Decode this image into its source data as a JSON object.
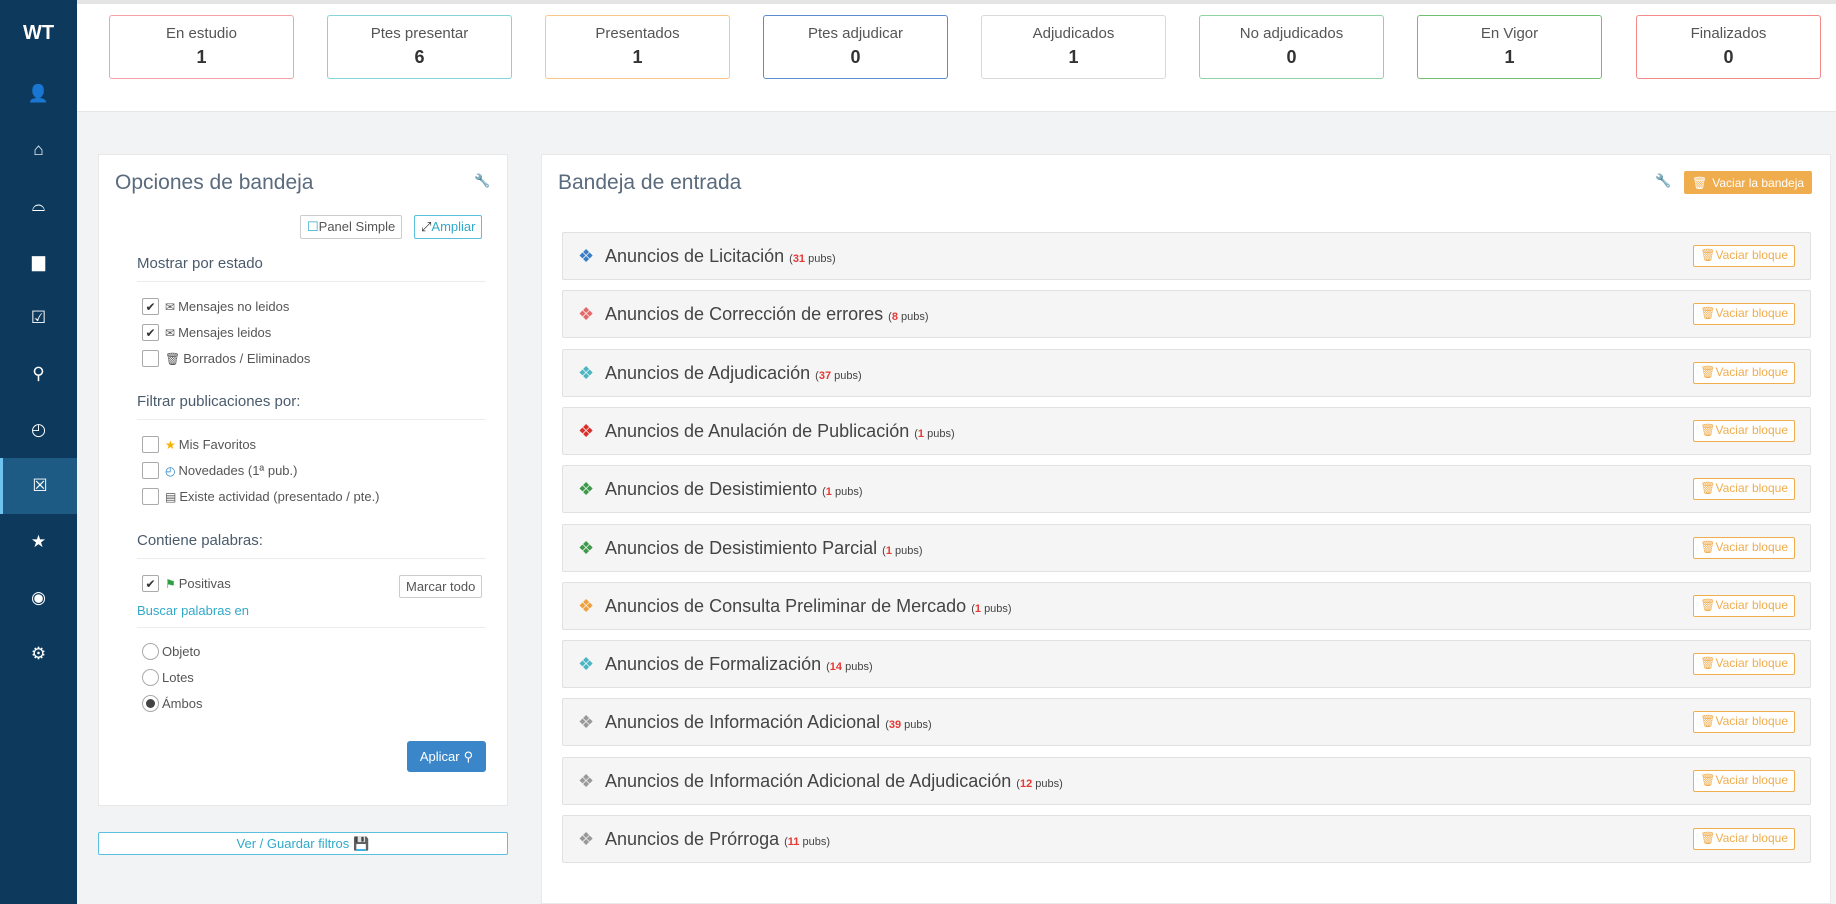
{
  "sidebar": {
    "logo": "WT",
    "items": [
      {
        "icon": "user-icon",
        "glyph": "👤"
      },
      {
        "icon": "home-icon",
        "glyph": "⌂"
      },
      {
        "icon": "inbox-icon",
        "glyph": "⌓"
      },
      {
        "icon": "archive-icon",
        "glyph": "▆"
      },
      {
        "icon": "calendar-check-icon",
        "glyph": "☑"
      },
      {
        "icon": "search-icon",
        "glyph": "⚲"
      },
      {
        "icon": "clock-icon",
        "glyph": "◴"
      },
      {
        "icon": "calendar-x-icon",
        "glyph": "☒"
      },
      {
        "icon": "star-icon",
        "glyph": "★"
      },
      {
        "icon": "user-circle-icon",
        "glyph": "◉"
      },
      {
        "icon": "gear-icon",
        "glyph": "⚙"
      }
    ]
  },
  "stats": [
    {
      "label": "En estudio",
      "value": "1",
      "color": "#f2a2a8"
    },
    {
      "label": "Ptes presentar",
      "value": "6",
      "color": "#86d3d9"
    },
    {
      "label": "Presentados",
      "value": "1",
      "color": "#f9c78a"
    },
    {
      "label": "Ptes adjudicar",
      "value": "0",
      "color": "#5b8dcc"
    },
    {
      "label": "Adjudicados",
      "value": "1",
      "color": "#d9d9d9"
    },
    {
      "label": "No adjudicados",
      "value": "0",
      "color": "#8fd4a5"
    },
    {
      "label": "En Vigor",
      "value": "1",
      "color": "#6fbf6f"
    },
    {
      "label": "Finalizados",
      "value": "0",
      "color": "#f28a8a"
    }
  ],
  "options": {
    "title": "Opciones de bandeja",
    "panel_simple": "Panel Simple",
    "ampliar": "Ampliar",
    "mostrar_por_estado": "Mostrar por estado",
    "mensajes_no_leidos": "Mensajes no leidos",
    "mensajes_leidos": "Mensajes leidos",
    "borrados": "Borrados / Eliminados",
    "filtrar_por": "Filtrar publicaciones por:",
    "mis_favoritos": "Mis Favoritos",
    "novedades": "Novedades (1ª pub.)",
    "existe_actividad": "Existe actividad (presentado / pte.)",
    "contiene_palabras": "Contiene palabras:",
    "positivas": "Positivas",
    "marcar_todo": "Marcar todo",
    "buscar_palabras_en": "Buscar palabras en",
    "objeto": "Objeto",
    "lotes": "Lotes",
    "ambos": "Ámbos",
    "aplicar": "Aplicar",
    "ver_guardar": "Ver / Guardar filtros"
  },
  "inbox": {
    "title": "Bandeja de entrada",
    "vaciar_bandeja": "Vaciar la bandeja",
    "vaciar_bloque": "Vaciar bloque",
    "pubs_word": "pubs",
    "rows": [
      {
        "label": "Anuncios de Licitación",
        "count": "31",
        "color": "#3a7fc4"
      },
      {
        "label": "Anuncios de Corrección de errores",
        "count": "8",
        "color": "#e46a6a"
      },
      {
        "label": "Anuncios de Adjudicación",
        "count": "37",
        "color": "#4bb5c4"
      },
      {
        "label": "Anuncios de Anulación de Publicación",
        "count": "1",
        "color": "#d9302b"
      },
      {
        "label": "Anuncios de Desistimiento",
        "count": "1",
        "color": "#3e9a4a"
      },
      {
        "label": "Anuncios de Desistimiento Parcial",
        "count": "1",
        "color": "#3e9a4a"
      },
      {
        "label": "Anuncios de Consulta Preliminar de Mercado",
        "count": "1",
        "color": "#f0a03c"
      },
      {
        "label": "Anuncios de Formalización",
        "count": "14",
        "color": "#4bb5c4"
      },
      {
        "label": "Anuncios de Información Adicional",
        "count": "39",
        "color": "#999999"
      },
      {
        "label": "Anuncios de Información Adicional de Adjudicación",
        "count": "12",
        "color": "#999999"
      },
      {
        "label": "Anuncios de Prórroga",
        "count": "11",
        "color": "#999999"
      }
    ]
  }
}
